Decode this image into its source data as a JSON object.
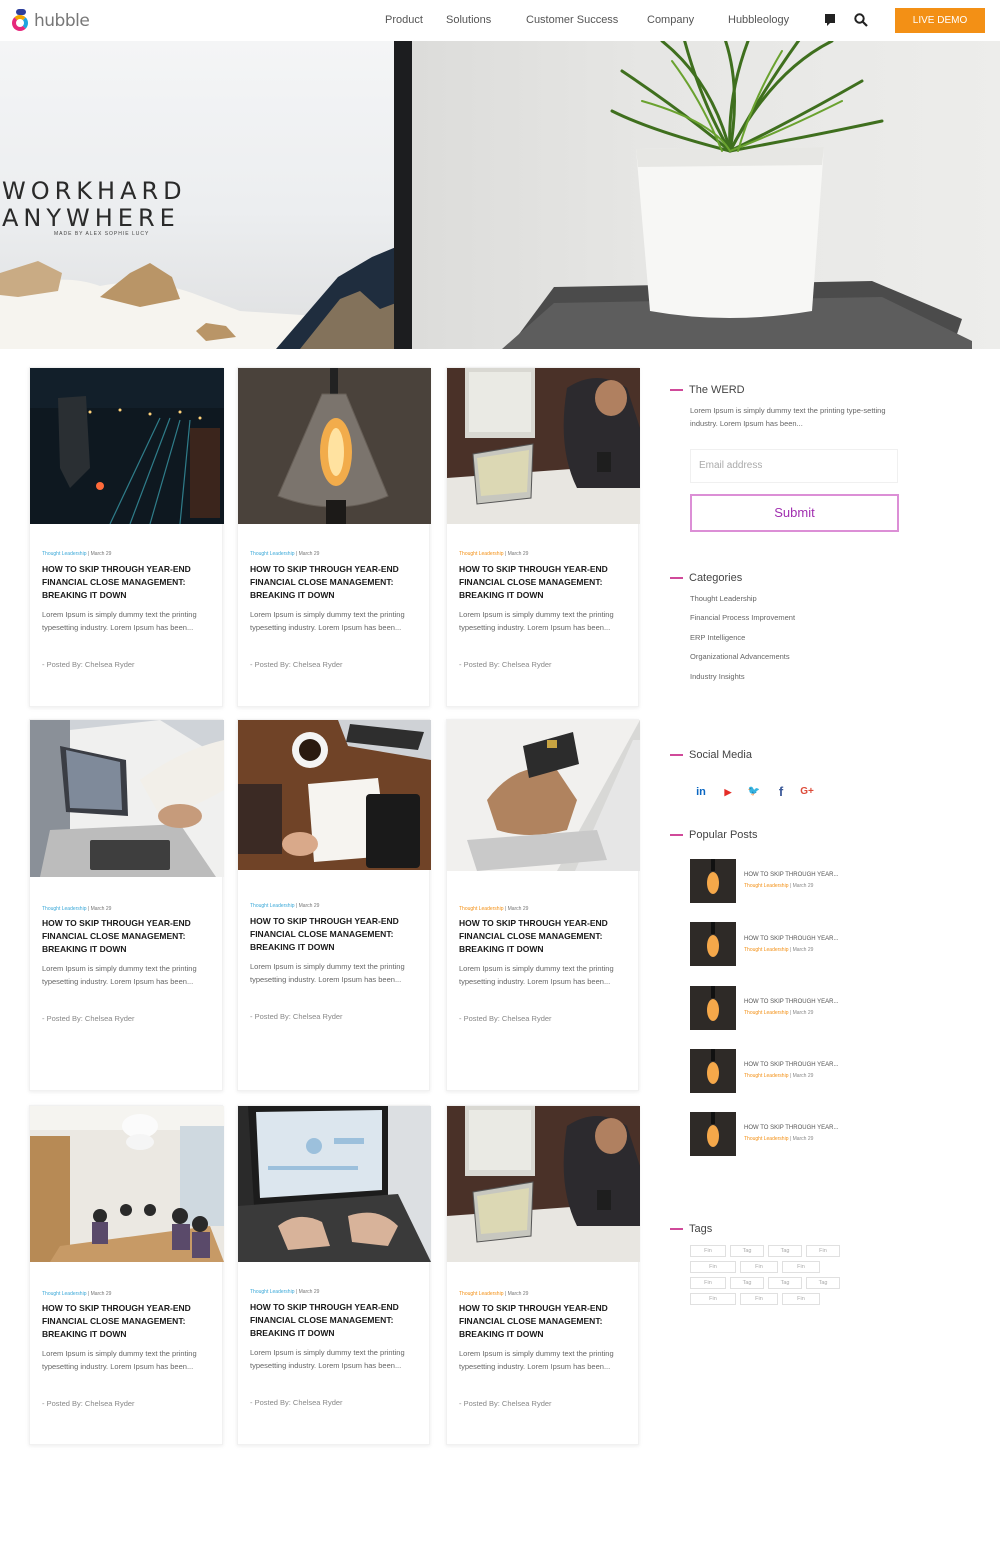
{
  "header": {
    "logo_text": "hubble",
    "nav": [
      "Product",
      "Solutions",
      "Customer Success",
      "Company",
      "Hubbleology"
    ],
    "cta": "LIVE DEMO"
  },
  "hero": {
    "title_line1": "WORKHARD",
    "title_line2": "ANYWHERE",
    "credit": "MADE BY ALEX SOPHIE LUCY"
  },
  "posts": [
    {
      "category": "Thought Leadership",
      "date": "March 29",
      "title": "HOW TO SKIP THROUGH YEAR-END FINANCIAL CLOSE MANAGEMENT: BREAKING IT DOWN",
      "excerpt": "Lorem Ipsum is simply dummy text the printing typesetting industry. Lorem Ipsum has been...",
      "author": "- Posted By: Chelsea Ryder"
    },
    {
      "category": "Thought Leadership",
      "date": "March 29",
      "title": "HOW TO SKIP THROUGH YEAR-END FINANCIAL CLOSE MANAGEMENT: BREAKING IT DOWN",
      "excerpt": "Lorem Ipsum is simply dummy text the printing typesetting industry. Lorem Ipsum has been...",
      "author": "- Posted By: Chelsea Ryder"
    },
    {
      "category": "Thought Leadership",
      "date": "March 29",
      "title": "HOW TO SKIP THROUGH YEAR-END FINANCIAL CLOSE MANAGEMENT: BREAKING IT DOWN",
      "excerpt": "Lorem Ipsum is simply dummy text the printing typesetting industry. Lorem Ipsum has been...",
      "author": "- Posted By: Chelsea Ryder"
    },
    {
      "category": "Thought Leadership",
      "date": "March 29",
      "title": "HOW TO SKIP THROUGH YEAR-END FINANCIAL CLOSE MANAGEMENT: BREAKING IT DOWN",
      "excerpt": "Lorem Ipsum is simply dummy text the printing typesetting industry. Lorem Ipsum has been...",
      "author": "- Posted By: Chelsea Ryder"
    },
    {
      "category": "Thought Leadership",
      "date": "March 29",
      "title": "HOW TO SKIP THROUGH YEAR-END FINANCIAL CLOSE MANAGEMENT: BREAKING IT DOWN",
      "excerpt": "Lorem Ipsum is simply dummy text the printing typesetting industry. Lorem Ipsum has been...",
      "author": "- Posted By: Chelsea Ryder"
    },
    {
      "category": "Thought Leadership",
      "date": "March 29",
      "title": "HOW TO SKIP THROUGH YEAR-END FINANCIAL CLOSE MANAGEMENT: BREAKING IT DOWN",
      "excerpt": "Lorem Ipsum is simply dummy text the printing typesetting industry. Lorem Ipsum has been...",
      "author": "- Posted By: Chelsea Ryder"
    },
    {
      "category": "Thought Leadership",
      "date": "March 29",
      "title": "HOW TO SKIP THROUGH YEAR-END FINANCIAL CLOSE MANAGEMENT: BREAKING IT DOWN",
      "excerpt": "Lorem Ipsum is simply dummy text the printing typesetting industry. Lorem Ipsum has been...",
      "author": "- Posted By: Chelsea Ryder"
    },
    {
      "category": "Thought Leadership",
      "date": "March 29",
      "title": "HOW TO SKIP THROUGH YEAR-END FINANCIAL CLOSE MANAGEMENT: BREAKING IT DOWN",
      "excerpt": "Lorem Ipsum is simply dummy text the printing typesetting industry. Lorem Ipsum has been...",
      "author": "- Posted By: Chelsea Ryder"
    },
    {
      "category": "Thought Leadership",
      "date": "March 29",
      "title": "HOW TO SKIP THROUGH YEAR-END FINANCIAL CLOSE MANAGEMENT: BREAKING IT DOWN",
      "excerpt": "Lorem Ipsum is simply dummy text the printing typesetting industry. Lorem Ipsum has been...",
      "author": "- Posted By: Chelsea Ryder"
    }
  ],
  "sidebar": {
    "werd": {
      "heading": "The WERD",
      "text": "Lorem Ipsum is simply dummy text the printing type-setting industry. Lorem Ipsum has been...",
      "email_placeholder": "Email address",
      "submit": "Submit"
    },
    "categories": {
      "heading": "Categories",
      "items": [
        "Thought Leadership",
        "Financial Process Improvement",
        "ERP Intelligence",
        "Organizational Advancements",
        "Industry Insights"
      ]
    },
    "social": {
      "heading": "Social Media",
      "icons": [
        {
          "name": "linkedin-icon",
          "glyph": "in",
          "color": "#0a66c2"
        },
        {
          "name": "youtube-icon",
          "glyph": "▶",
          "color": "#e52d27"
        },
        {
          "name": "twitter-icon",
          "glyph": "🐦",
          "color": "#1da1f2"
        },
        {
          "name": "facebook-icon",
          "glyph": "f",
          "color": "#3b5998"
        },
        {
          "name": "google-plus-icon",
          "glyph": "G+",
          "color": "#dd4b39"
        }
      ]
    },
    "popular": {
      "heading": "Popular Posts",
      "items": [
        {
          "title": "HOW TO SKIP THROUGH YEAR...",
          "category": "Thought Leadership",
          "date": "March 29"
        },
        {
          "title": "HOW TO SKIP THROUGH YEAR...",
          "category": "Thought Leadership",
          "date": "March 29"
        },
        {
          "title": "HOW TO SKIP THROUGH YEAR...",
          "category": "Thought Leadership",
          "date": "March 29"
        },
        {
          "title": "HOW TO SKIP THROUGH YEAR...",
          "category": "Thought Leadership",
          "date": "March 29"
        },
        {
          "title": "HOW TO SKIP THROUGH YEAR...",
          "category": "Thought Leadership",
          "date": "March 29"
        }
      ]
    },
    "tags": {
      "heading": "Tags",
      "items": [
        "Fin",
        "Tag",
        "Tag",
        "Fin",
        "Fin",
        "Fin",
        "Fin",
        "Fin",
        "Tag",
        "Tag",
        "Tag",
        "Fin",
        "Fin",
        "Fin"
      ]
    }
  },
  "colors": {
    "accent": "#f39015",
    "pink": "#d04a9a",
    "submit_border": "#dc8fd6",
    "link_blue": "#3aa8d8"
  }
}
